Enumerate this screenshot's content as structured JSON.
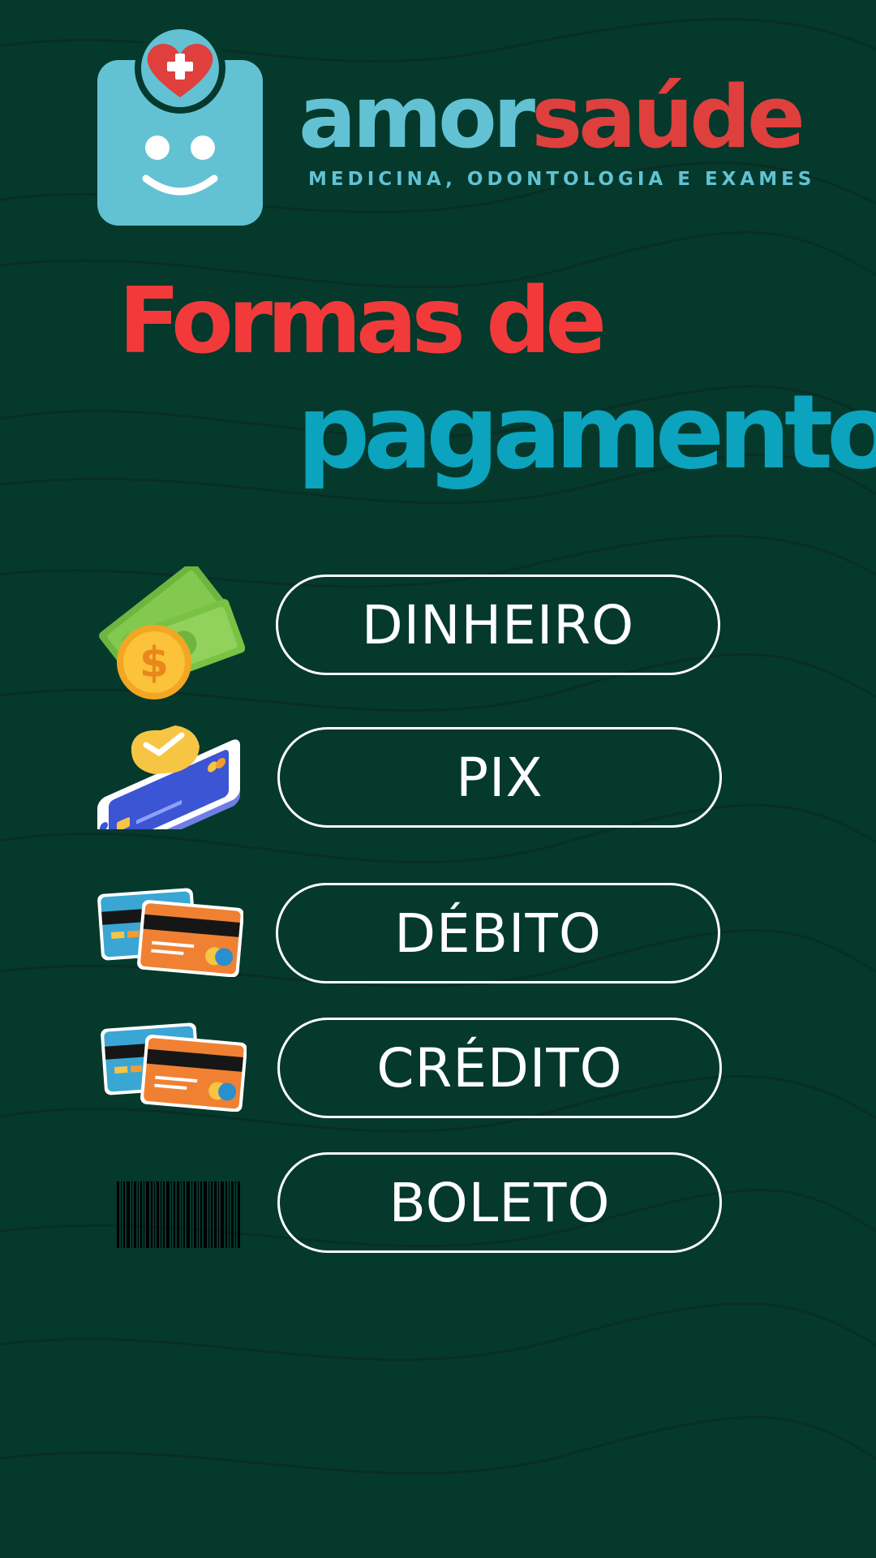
{
  "brand": {
    "name_part1": "amor",
    "name_part2": "saúde",
    "tagline": "MEDICINA, ODONTOLOGIA E EXAMES",
    "logo_icon": "smiling-clipboard-heart-icon"
  },
  "title": {
    "line1": "Formas de",
    "line2": "pagamento"
  },
  "colors": {
    "background": "#04392c",
    "brand_light_blue": "#62c2d3",
    "brand_red": "#df3f3d",
    "title_red": "#f23a3a",
    "title_blue": "#0ca3be",
    "button_border": "#ffffff"
  },
  "payments": [
    {
      "label": "DINHEIRO",
      "icon": "cash-coin-icon"
    },
    {
      "label": "PIX",
      "icon": "phone-pix-icon"
    },
    {
      "label": "DÉBITO",
      "icon": "debit-cards-icon"
    },
    {
      "label": "CRÉDITO",
      "icon": "credit-cards-icon"
    },
    {
      "label": "BOLETO",
      "icon": "barcode-icon"
    }
  ]
}
